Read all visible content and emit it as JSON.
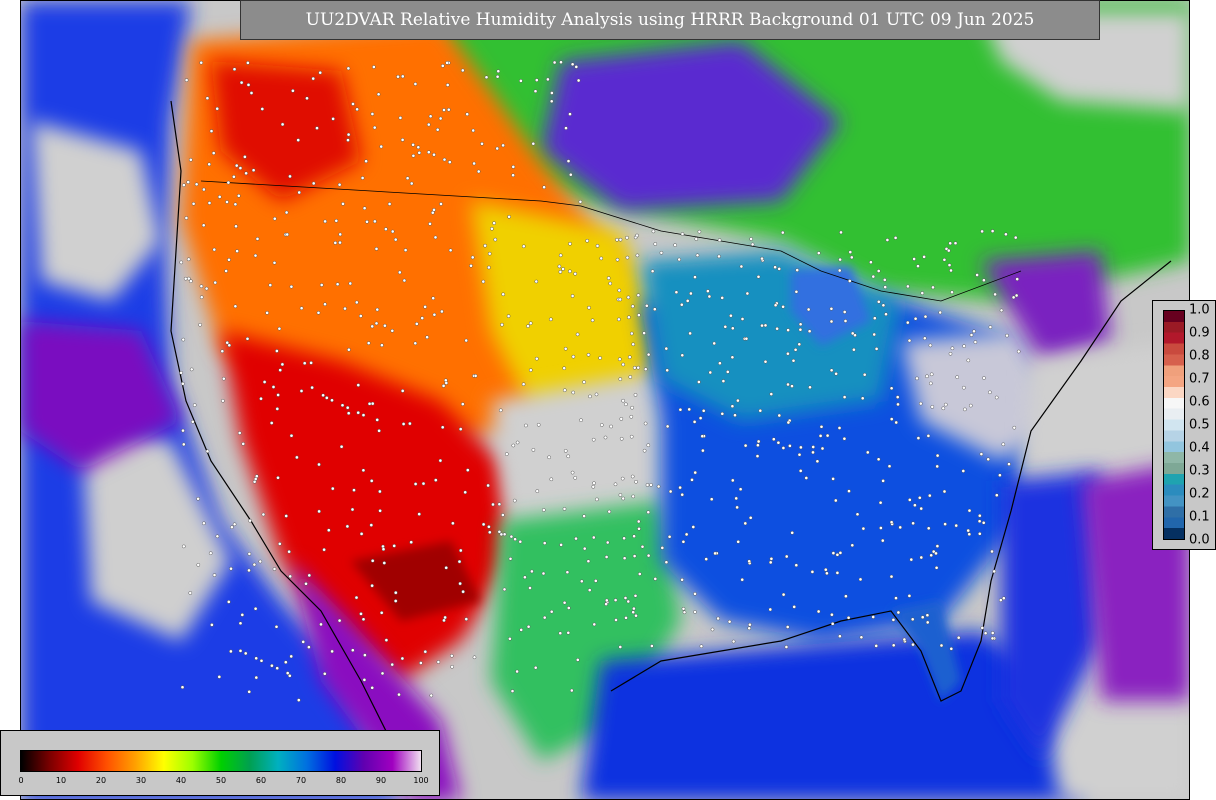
{
  "title": "UU2DVAR Relative Humidity Analysis using HRRR Background 01 UTC 09 Jun 2025",
  "rh_colorbar": {
    "ticks": [
      "0",
      "10",
      "20",
      "30",
      "40",
      "50",
      "60",
      "70",
      "80",
      "90",
      "100"
    ],
    "colors": [
      "#000000",
      "#7a0000",
      "#e00000",
      "#ff5000",
      "#ffa000",
      "#ffff00",
      "#9cff00",
      "#00d000",
      "#00a050",
      "#00b0c0",
      "#0070e0",
      "#0010e0",
      "#6000b0",
      "#a000c0",
      "#f0e0f0"
    ]
  },
  "increment_colorbar": {
    "ticks": [
      "1.0",
      "0.9",
      "0.8",
      "0.7",
      "0.6",
      "0.5",
      "0.4",
      "0.3",
      "0.2",
      "0.1",
      "0.0"
    ],
    "colors": [
      "#67001f",
      "#9a1a25",
      "#b2182b",
      "#c94a3e",
      "#d6604d",
      "#f0a07c",
      "#f4a582",
      "#fbd7c4",
      "#f7f7f7",
      "#e9eef2",
      "#d1e5f0",
      "#b6d3e6",
      "#92c5de",
      "#8fb7a7",
      "#7ea896",
      "#1fa3b0",
      "#2b8cbe",
      "#4393c3",
      "#2f6fa7",
      "#2166ac",
      "#053061"
    ]
  },
  "map": {
    "regions": [
      {
        "name": "pacific-ocean",
        "color": "#1a3ce6"
      },
      {
        "name": "gulf-of-mexico",
        "color": "#1030e0"
      },
      {
        "name": "atlantic-ocean",
        "color": "#d0d0d0"
      },
      {
        "name": "west-dry",
        "color": "#ff7000"
      },
      {
        "name": "southwest-very-dry",
        "color": "#e00000"
      },
      {
        "name": "plains-moderate",
        "color": "#f0d000"
      },
      {
        "name": "central-mid",
        "color": "#20c020"
      },
      {
        "name": "east-humid",
        "color": "#1050e0"
      },
      {
        "name": "canada-green",
        "color": "#30c030"
      },
      {
        "name": "great-lakes",
        "color": "#3070e0"
      }
    ],
    "observation_color": "#ffffff"
  }
}
